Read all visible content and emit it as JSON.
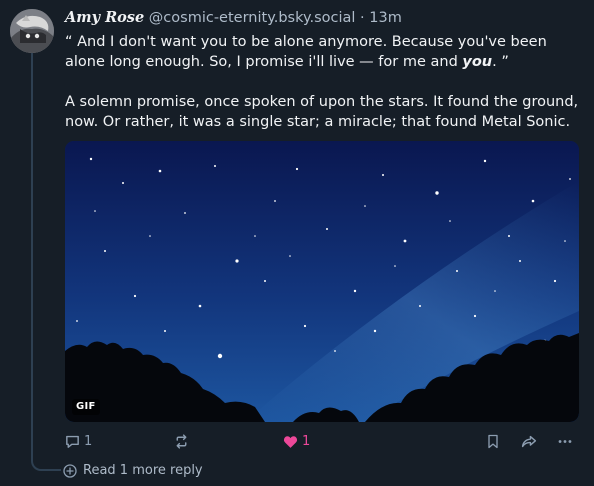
{
  "post": {
    "display_name": "Amy Rose",
    "handle": "@cosmic-eternity.bsky.social",
    "separator": "·",
    "time": "13m",
    "avatar_icon": "avatar-icon",
    "text_line1_start": "“ And I don't want you to be alone anymore. Because you've been alone long enough. So, I promise i'll live — for me and ",
    "text_line1_emph": "you",
    "text_line1_end": ". ”",
    "text_para2": "A solemn promise, once spoken of upon the stars. It found the ground, now. Or rather, it was a single star; a miracle; that found Metal Sonic.",
    "media_badge": "GIF"
  },
  "actions": {
    "reply_count": "1",
    "repost_count": "",
    "like_count": "1",
    "like_color": "#ec4899"
  },
  "thread": {
    "read_more_label": "Read 1 more reply"
  }
}
